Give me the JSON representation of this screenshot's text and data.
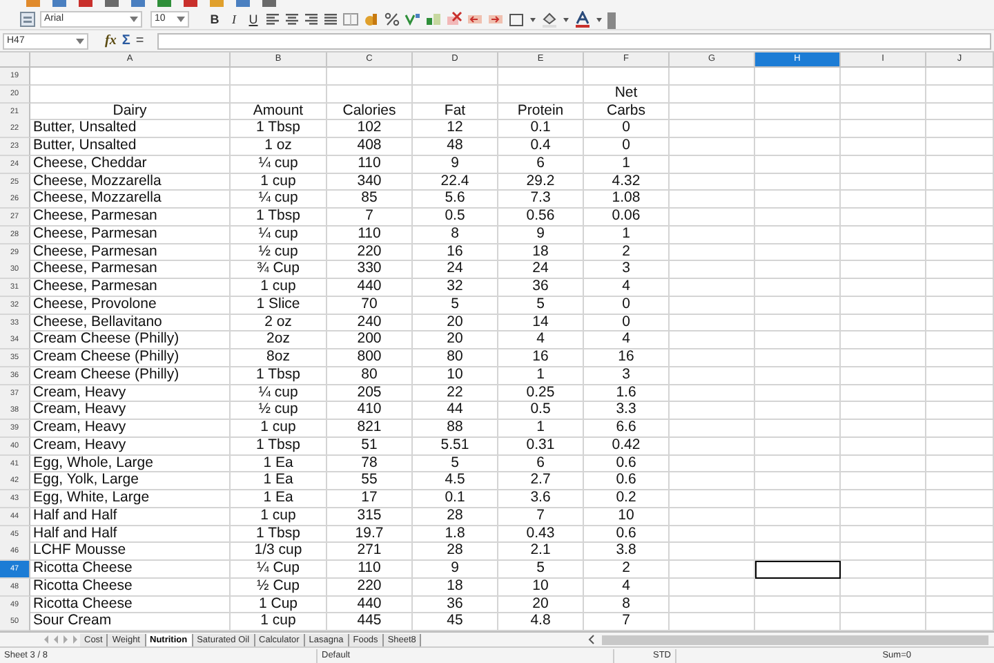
{
  "format_toolbar": {
    "font_name": "Arial",
    "font_size": "10",
    "bold": "B",
    "italic": "I",
    "underline": "U"
  },
  "formula_bar": {
    "cell_reference": "H47",
    "function_wizard": "fx",
    "sum": "Σ",
    "equals": "="
  },
  "columns": [
    {
      "label": "A",
      "selected": false
    },
    {
      "label": "B",
      "selected": false
    },
    {
      "label": "C",
      "selected": false
    },
    {
      "label": "D",
      "selected": false
    },
    {
      "label": "E",
      "selected": false
    },
    {
      "label": "F",
      "selected": false
    },
    {
      "label": "G",
      "selected": false
    },
    {
      "label": "H",
      "selected": true
    },
    {
      "label": "I",
      "selected": false
    },
    {
      "label": "J",
      "selected": false
    }
  ],
  "rows": [
    {
      "number": "19",
      "kind": "blank",
      "selected": false,
      "cells": []
    },
    {
      "number": "20",
      "kind": "heading",
      "selected": false,
      "cells": [
        "",
        "",
        "",
        "",
        "",
        "Net"
      ]
    },
    {
      "number": "21",
      "kind": "heading",
      "selected": false,
      "cells": [
        "Dairy",
        "Amount",
        "Calories",
        "Fat",
        "Protein",
        "Carbs"
      ]
    },
    {
      "number": "22",
      "kind": "data",
      "selected": false,
      "cells": [
        "Butter, Unsalted",
        "1 Tbsp",
        "102",
        "12",
        "0.1",
        "0"
      ]
    },
    {
      "number": "23",
      "kind": "data",
      "selected": false,
      "cells": [
        "Butter, Unsalted",
        "1 oz",
        "408",
        "48",
        "0.4",
        "0"
      ]
    },
    {
      "number": "24",
      "kind": "data",
      "selected": false,
      "cells": [
        "Cheese, Cheddar",
        "¼ cup",
        "110",
        "9",
        "6",
        "1"
      ]
    },
    {
      "number": "25",
      "kind": "data",
      "selected": false,
      "cells": [
        "Cheese, Mozzarella",
        "1 cup",
        "340",
        "22.4",
        "29.2",
        "4.32"
      ]
    },
    {
      "number": "26",
      "kind": "data",
      "selected": false,
      "cells": [
        "Cheese, Mozzarella",
        "¼ cup",
        "85",
        "5.6",
        "7.3",
        "1.08"
      ]
    },
    {
      "number": "27",
      "kind": "data",
      "selected": false,
      "cells": [
        "Cheese, Parmesan",
        "1 Tbsp",
        "7",
        "0.5",
        "0.56",
        "0.06"
      ]
    },
    {
      "number": "28",
      "kind": "data",
      "selected": false,
      "cells": [
        "Cheese, Parmesan",
        "¼ cup",
        "110",
        "8",
        "9",
        "1"
      ]
    },
    {
      "number": "29",
      "kind": "data",
      "selected": false,
      "cells": [
        "Cheese, Parmesan",
        "½ cup",
        "220",
        "16",
        "18",
        "2"
      ]
    },
    {
      "number": "30",
      "kind": "data",
      "selected": false,
      "cells": [
        "Cheese, Parmesan",
        "¾ Cup",
        "330",
        "24",
        "24",
        "3"
      ]
    },
    {
      "number": "31",
      "kind": "data",
      "selected": false,
      "cells": [
        "Cheese, Parmesan",
        "1 cup",
        "440",
        "32",
        "36",
        "4"
      ]
    },
    {
      "number": "32",
      "kind": "data",
      "selected": false,
      "cells": [
        "Cheese, Provolone",
        "1 Slice",
        "70",
        "5",
        "5",
        "0"
      ]
    },
    {
      "number": "33",
      "kind": "data",
      "selected": false,
      "cells": [
        "Cheese, Bellavitano",
        "2 oz",
        "240",
        "20",
        "14",
        "0"
      ]
    },
    {
      "number": "34",
      "kind": "data",
      "selected": false,
      "cells": [
        "Cream Cheese (Philly)",
        "2oz",
        "200",
        "20",
        "4",
        "4"
      ]
    },
    {
      "number": "35",
      "kind": "data",
      "selected": false,
      "cells": [
        "Cream Cheese (Philly)",
        "8oz",
        "800",
        "80",
        "16",
        "16"
      ]
    },
    {
      "number": "36",
      "kind": "data",
      "selected": false,
      "cells": [
        "Cream Cheese (Philly)",
        "1 Tbsp",
        "80",
        "10",
        "1",
        "3"
      ]
    },
    {
      "number": "37",
      "kind": "data",
      "selected": false,
      "cells": [
        "Cream, Heavy",
        "¼ cup",
        "205",
        "22",
        "0.25",
        "1.6"
      ]
    },
    {
      "number": "38",
      "kind": "data",
      "selected": false,
      "cells": [
        "Cream, Heavy",
        "½ cup",
        "410",
        "44",
        "0.5",
        "3.3"
      ]
    },
    {
      "number": "39",
      "kind": "data",
      "selected": false,
      "cells": [
        "Cream, Heavy",
        "1 cup",
        "821",
        "88",
        "1",
        "6.6"
      ]
    },
    {
      "number": "40",
      "kind": "data",
      "selected": false,
      "cells": [
        "Cream, Heavy",
        "1 Tbsp",
        "51",
        "5.51",
        "0.31",
        "0.42"
      ]
    },
    {
      "number": "41",
      "kind": "data",
      "selected": false,
      "cells": [
        "Egg, Whole, Large",
        "1 Ea",
        "78",
        "5",
        "6",
        "0.6"
      ]
    },
    {
      "number": "42",
      "kind": "data",
      "selected": false,
      "cells": [
        "Egg, Yolk, Large",
        "1 Ea",
        "55",
        "4.5",
        "2.7",
        "0.6"
      ]
    },
    {
      "number": "43",
      "kind": "data",
      "selected": false,
      "cells": [
        "Egg, White, Large",
        "1 Ea",
        "17",
        "0.1",
        "3.6",
        "0.2"
      ]
    },
    {
      "number": "44",
      "kind": "data",
      "selected": false,
      "cells": [
        "Half and Half",
        "1 cup",
        "315",
        "28",
        "7",
        "10"
      ]
    },
    {
      "number": "45",
      "kind": "data",
      "selected": false,
      "cells": [
        "Half and Half",
        "1 Tbsp",
        "19.7",
        "1.8",
        "0.43",
        "0.6"
      ]
    },
    {
      "number": "46",
      "kind": "data",
      "selected": false,
      "cells": [
        "LCHF Mousse",
        "1/3 cup",
        "271",
        "28",
        "2.1",
        "3.8"
      ]
    },
    {
      "number": "47",
      "kind": "data",
      "selected": true,
      "cells": [
        "Ricotta Cheese",
        "¼  Cup",
        "110",
        "9",
        "5",
        "2"
      ]
    },
    {
      "number": "48",
      "kind": "data",
      "selected": false,
      "cells": [
        "Ricotta Cheese",
        "½  Cup",
        "220",
        "18",
        "10",
        "4"
      ]
    },
    {
      "number": "49",
      "kind": "data",
      "selected": false,
      "cells": [
        "Ricotta Cheese",
        "1 Cup",
        "440",
        "36",
        "20",
        "8"
      ]
    },
    {
      "number": "50",
      "kind": "data",
      "selected": false,
      "cells": [
        "Sour Cream",
        "1 cup",
        "445",
        "45",
        "4.8",
        "7"
      ]
    }
  ],
  "sheet_tabs": [
    {
      "label": "Cost",
      "selected": false
    },
    {
      "label": "Weight",
      "selected": false
    },
    {
      "label": "Nutrition",
      "selected": true
    },
    {
      "label": "Saturated Oil",
      "selected": false
    },
    {
      "label": "Calculator",
      "selected": false
    },
    {
      "label": "Lasagna",
      "selected": false
    },
    {
      "label": "Foods",
      "selected": false
    },
    {
      "label": "Sheet8",
      "selected": false
    }
  ],
  "status_bar": {
    "sheet": "Sheet 3 / 8",
    "page_style": "Default",
    "selection_mode": "STD",
    "sum": "Sum=0"
  }
}
